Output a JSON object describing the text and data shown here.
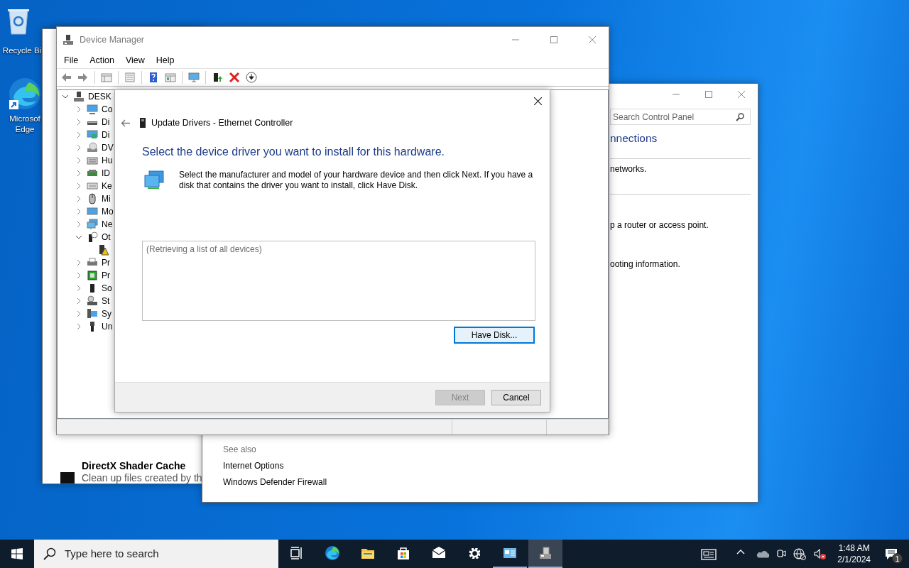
{
  "desktop_icons": [
    {
      "lines": [
        "Recycle Bi"
      ]
    },
    {
      "lines": [
        "Microsof",
        "Edge"
      ]
    }
  ],
  "cleanup_window": {
    "items": [
      {
        "title": "DirectX Shader Cache",
        "description": "Clean up files created by th"
      }
    ]
  },
  "control_panel": {
    "search": {
      "placeholder": "Search Control Panel"
    },
    "heading": "nnections",
    "lines": [
      "networks.",
      "p a router or access point.",
      "ooting information."
    ],
    "see_also": {
      "title": "See also",
      "links": [
        "Internet Options",
        "Windows Defender Firewall"
      ]
    }
  },
  "device_manager": {
    "title": "Device Manager",
    "menu": [
      "File",
      "Action",
      "View",
      "Help"
    ],
    "tree": {
      "label": "DESK",
      "expanded": true,
      "children": [
        {
          "label": "Co",
          "expanded": false
        },
        {
          "label": "Di",
          "expanded": false
        },
        {
          "label": "Di",
          "expanded": false
        },
        {
          "label": "DV",
          "expanded": false
        },
        {
          "label": "Hu",
          "expanded": false
        },
        {
          "label": "ID",
          "expanded": false
        },
        {
          "label": "Ke",
          "expanded": false
        },
        {
          "label": "Mi",
          "expanded": false
        },
        {
          "label": "Mo",
          "expanded": false
        },
        {
          "label": "Ne",
          "expanded": false
        },
        {
          "label": "Ot",
          "expanded": true,
          "children": [
            {
              "kind": "warning"
            }
          ]
        },
        {
          "label": "Pr",
          "expanded": false
        },
        {
          "label": "Pr",
          "expanded": false
        },
        {
          "label": "So",
          "expanded": false
        },
        {
          "label": "St",
          "expanded": false
        },
        {
          "label": "Sy",
          "expanded": false
        },
        {
          "label": "Un",
          "expanded": false
        }
      ]
    }
  },
  "dialog": {
    "title": "Update Drivers - Ethernet Controller",
    "heading": "Select the device driver you want to install for this hardware.",
    "description": "Select the manufacturer and model of your hardware device and then click Next. If you have a disk that contains the driver you want to install, click Have Disk.",
    "list_message": "(Retrieving a list of all devices)",
    "have_disk": {
      "label": "Have Disk...",
      "focused": true
    },
    "buttons": [
      {
        "label": "Next",
        "disabled": true
      },
      {
        "label": "Cancel",
        "disabled": false
      }
    ]
  },
  "taskbar": {
    "search_placeholder": "Type here to search",
    "apps": [
      {
        "kind": "taskview",
        "running": false,
        "active": false
      },
      {
        "kind": "browser",
        "running": false,
        "active": false
      },
      {
        "kind": "folder",
        "running": false,
        "active": false
      },
      {
        "kind": "store",
        "running": false,
        "active": false
      },
      {
        "kind": "mail",
        "running": false,
        "active": false
      },
      {
        "kind": "settings",
        "running": false,
        "active": false
      },
      {
        "kind": "panel",
        "running": true,
        "active": false
      },
      {
        "kind": "devices",
        "running": true,
        "active": true
      }
    ],
    "time": "1:48 AM",
    "date": "2/1/2024",
    "notifications": "1"
  }
}
